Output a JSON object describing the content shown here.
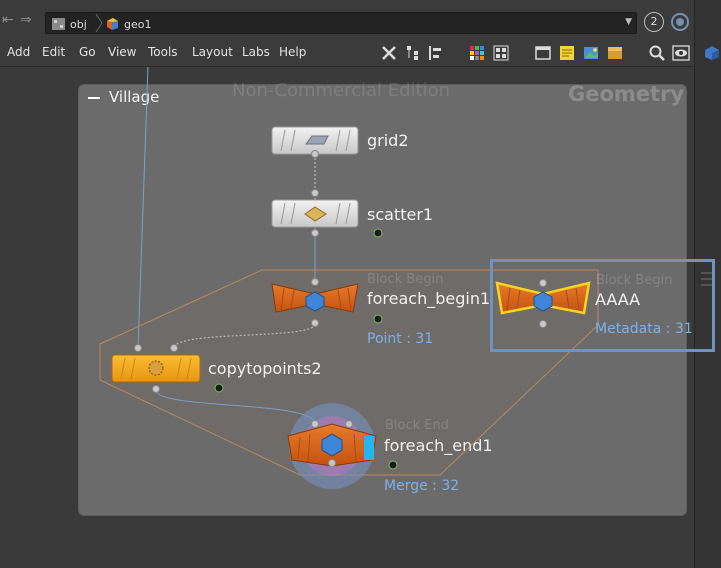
{
  "pathbar": {
    "path": [
      {
        "label": "obj",
        "icon": "network-icon"
      },
      {
        "label": "geo1",
        "icon": "geometry-object-icon"
      }
    ],
    "pane_number": "2"
  },
  "menu": {
    "items": [
      "Add",
      "Edit",
      "Go",
      "View",
      "Tools",
      "Layout",
      "Labs",
      "Help"
    ]
  },
  "network_box": {
    "title": "Village"
  },
  "watermark": {
    "edition": "Non-Commercial Edition",
    "context": "Geometry"
  },
  "nodes": {
    "grid": {
      "name": "grid2"
    },
    "scatter": {
      "name": "scatter1"
    },
    "foreach_begin": {
      "name": "foreach_begin1",
      "tag": "Block Begin",
      "info": "Point : 31"
    },
    "aaaa": {
      "name": "AAAA",
      "tag": "Block Begin",
      "info": "Metadata : 31"
    },
    "copytopoints": {
      "name": "copytopoints2"
    },
    "foreach_end": {
      "name": "foreach_end1",
      "tag": "Block End",
      "info": "Merge : 32"
    }
  },
  "colors": {
    "node_orange": "#d8651a",
    "node_gray": "#d6d6d6",
    "node_yellow": "#f2a91e",
    "selection": "#f7d51e",
    "info_text": "#7fb0e8",
    "netbox": "#6b6b6b"
  }
}
